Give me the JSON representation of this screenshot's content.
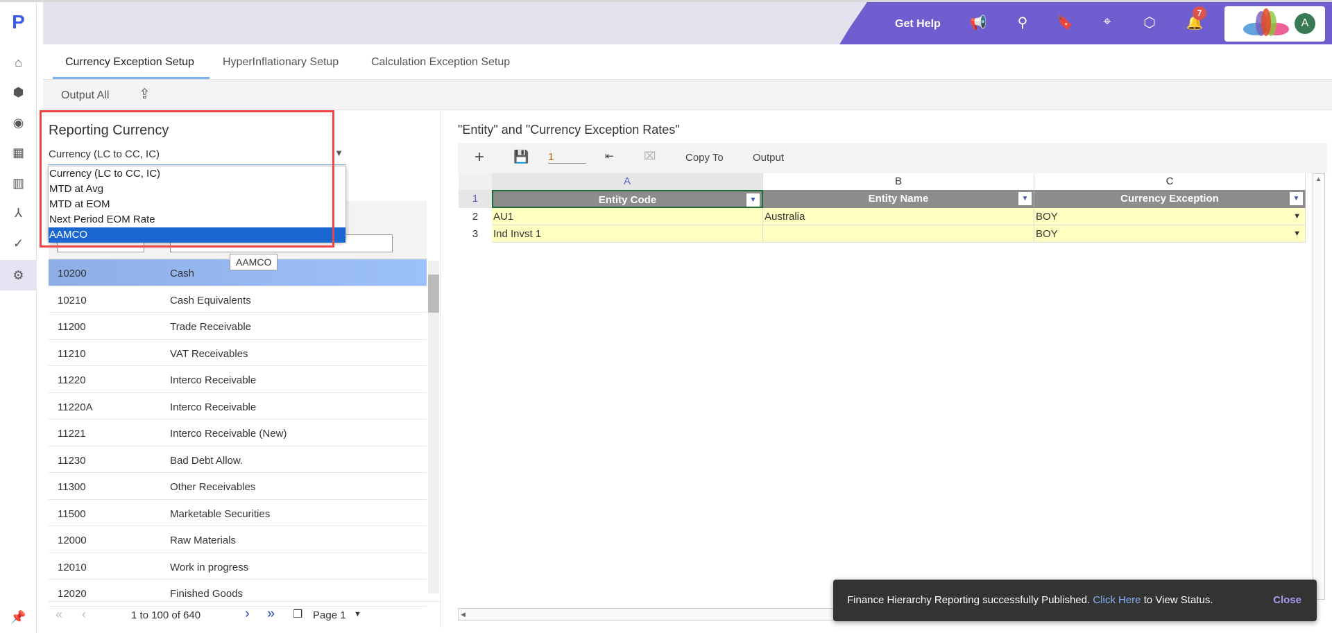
{
  "header": {
    "get_help": "Get Help",
    "notification_count": "7",
    "avatar_initial": "A"
  },
  "tabs": [
    {
      "label": "Currency Exception Setup"
    },
    {
      "label": "HyperInflationary Setup"
    },
    {
      "label": "Calculation Exception Setup"
    }
  ],
  "toolbar": {
    "output_all": "Output All"
  },
  "left": {
    "title": "Reporting Currency",
    "selected": "Currency (LC to CC, IC)",
    "options": [
      "Currency (LC to CC, IC)",
      "MTD at Avg",
      "MTD at EOM",
      "Next Period EOM Rate",
      "AAMCO"
    ],
    "tooltip": "AAMCO",
    "rows": [
      [
        "10200",
        "Cash"
      ],
      [
        "10210",
        "Cash Equivalents"
      ],
      [
        "11200",
        "Trade Receivable"
      ],
      [
        "11210",
        "VAT Receivables"
      ],
      [
        "11220",
        "Interco Receivable"
      ],
      [
        "11220A",
        "Interco Receivable"
      ],
      [
        "11221",
        "Interco Receivable (New)"
      ],
      [
        "11230",
        "Bad Debt Allow."
      ],
      [
        "11300",
        "Other Receivables"
      ],
      [
        "11500",
        "Marketable Securities"
      ],
      [
        "12000",
        "Raw Materials"
      ],
      [
        "12010",
        "Work in progress"
      ],
      [
        "12020",
        "Finished Goods"
      ]
    ],
    "pagination": {
      "range": "1 to 100 of 640",
      "page": "Page 1"
    }
  },
  "right": {
    "title": "\"Entity\" and \"Currency Exception Rates\"",
    "page_input": "1",
    "copy_to": "Copy To",
    "output": "Output",
    "col_letters": [
      "A",
      "B",
      "C"
    ],
    "headers": [
      "Entity Code",
      "Entity Name",
      "Currency Exception"
    ],
    "row_numbers": [
      "1",
      "2",
      "3"
    ],
    "rows": [
      [
        "AU1",
        "Australia",
        "BOY"
      ],
      [
        "Ind Invst 1",
        "",
        "BOY"
      ]
    ]
  },
  "toast": {
    "message": "Finance Hierarchy Reporting successfully Published.",
    "link": "Click Here",
    "suffix": "to View Status.",
    "close": "Close"
  },
  "colors": {
    "accent": "#6f5ecf",
    "selected_option": "#1a67d2",
    "highlight_border": "#ef4444",
    "cell_fill": "#ffffc2"
  }
}
